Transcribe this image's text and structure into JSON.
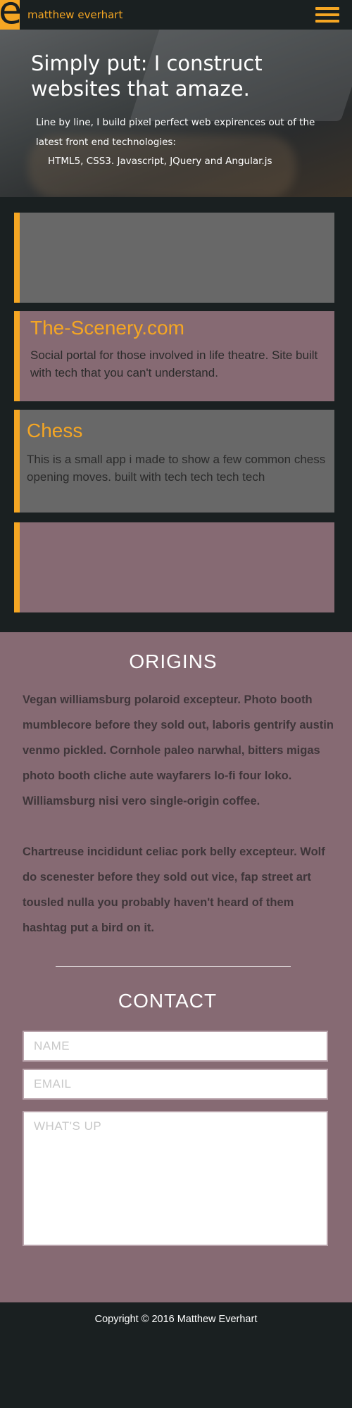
{
  "header": {
    "logo_letter": "e",
    "brand_name": "matthew everhart",
    "menu_icon": "hamburger-menu-icon"
  },
  "hero": {
    "title": "Simply put: I construct websites that amaze.",
    "text": "Line by line, I build pixel perfect web expirences out of the latest front end technologies:",
    "tech": "HTML5, CSS3. Javascript, JQuery and Angular.js"
  },
  "projects": [
    {
      "title": "",
      "description": ""
    },
    {
      "title": "The-Scenery.com",
      "description": "Social portal for those involved in life theatre. Site built with tech that you can't understand."
    },
    {
      "title": "Chess",
      "description": "This is a small app i made to show a few common chess opening moves. built with tech tech tech tech"
    },
    {
      "title": "",
      "description": ""
    }
  ],
  "origins": {
    "title": "ORIGINS",
    "paragraphs": [
      "Vegan williamsburg polaroid excepteur. Photo booth mumblecore before they sold out, laboris gentrify austin venmo pickled. Cornhole paleo narwhal, bitters migas photo booth cliche aute wayfarers lo-fi four loko. Williamsburg nisi vero single-origin coffee.",
      "Chartreuse incididunt celiac pork belly excepteur. Wolf do scenester before they sold out vice, fap street art tousled nulla you probably haven't heard of them hashtag put a bird on it."
    ]
  },
  "contact": {
    "title": "CONTACT",
    "name_placeholder": "NAME",
    "email_placeholder": "EMAIL",
    "message_placeholder": "WHAT'S UP"
  },
  "footer": {
    "copyright": "Copyright © 2016 Matthew Everhart"
  },
  "colors": {
    "accent": "#f5a623",
    "dark": "#1a2021",
    "card_grey": "#686868",
    "card_mauve": "#866a73"
  }
}
